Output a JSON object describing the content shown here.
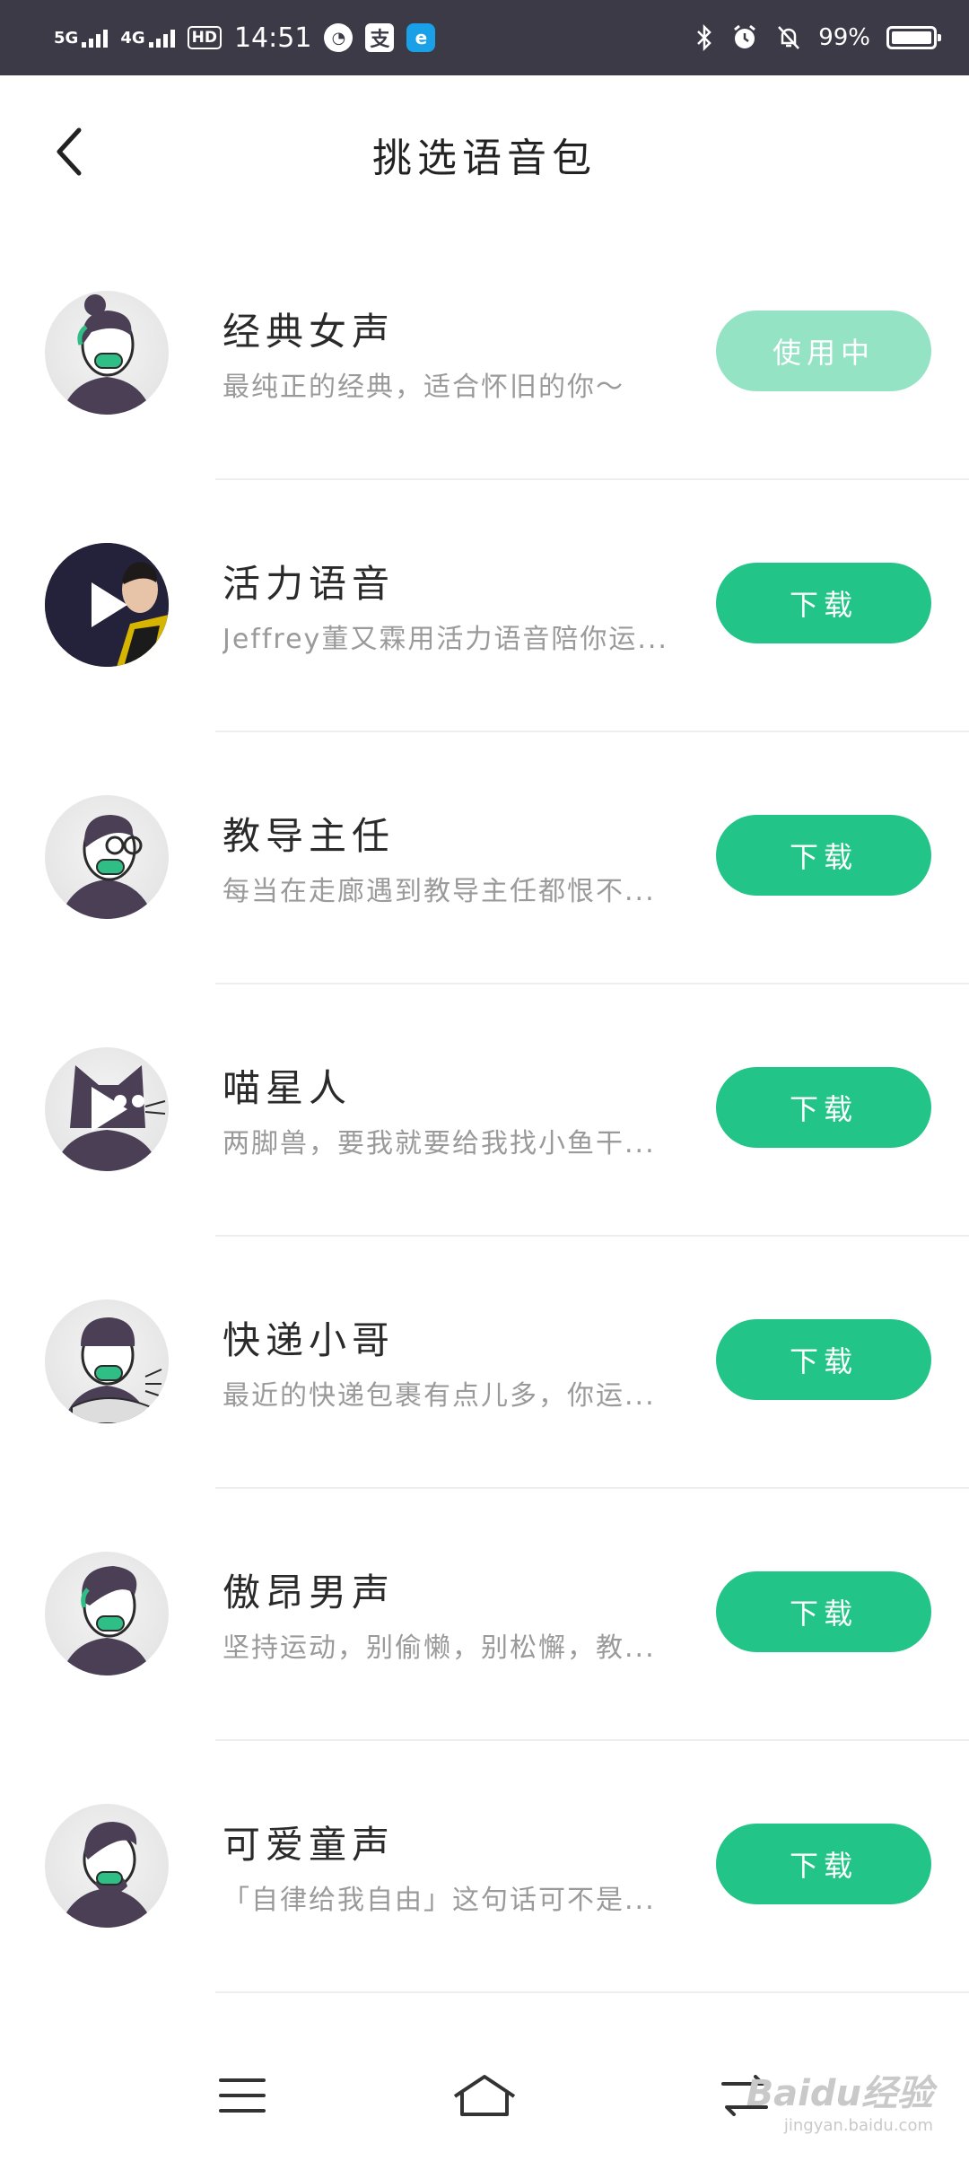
{
  "status_bar": {
    "network1": "5G",
    "network2": "4G",
    "hd": "HD",
    "time": "14:51",
    "app_icon_2": "支",
    "app_icon_3": "e",
    "battery": "99%"
  },
  "header": {
    "title": "挑选语音包"
  },
  "voices": [
    {
      "name": "经典女声",
      "desc": "最纯正的经典，适合怀旧的你～",
      "button": "使用中",
      "state": "in-use"
    },
    {
      "name": "活力语音",
      "desc": "Jeffrey董又霖用活力语音陪你运...",
      "button": "下载",
      "state": "download"
    },
    {
      "name": "教导主任",
      "desc": "每当在走廊遇到教导主任都恨不...",
      "button": "下载",
      "state": "download"
    },
    {
      "name": "喵星人",
      "desc": "两脚兽，要我就要给我找小鱼干...",
      "button": "下载",
      "state": "download"
    },
    {
      "name": "快递小哥",
      "desc": "最近的快递包裹有点儿多，你运...",
      "button": "下载",
      "state": "download"
    },
    {
      "name": "傲昂男声",
      "desc": "坚持运动，别偷懒，别松懈，教...",
      "button": "下载",
      "state": "download"
    },
    {
      "name": "可爱童声",
      "desc": "「自律给我自由」这句话可不是...",
      "button": "下载",
      "state": "download"
    }
  ],
  "watermark": {
    "brand": "Baidu经验",
    "url": "jingyan.baidu.com"
  },
  "colors": {
    "status_bar": "#3d3a47",
    "accent": "#22c487",
    "accent_disabled": "#94e3c5",
    "character": "#4a3f55",
    "headset": "#2fbf86"
  }
}
